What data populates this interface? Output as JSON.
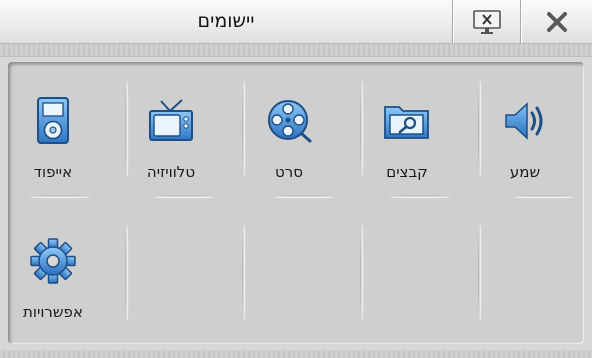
{
  "window": {
    "title": "יישומים",
    "buttons": [
      {
        "name": "display-button",
        "icon": "display-x-icon"
      },
      {
        "name": "close-button",
        "icon": "close-x-icon"
      }
    ]
  },
  "apps": [
    {
      "label": "שמע",
      "icon": "speaker-icon"
    },
    {
      "label": "קבצים",
      "icon": "folder-search-icon"
    },
    {
      "label": "סרט",
      "icon": "film-reel-icon"
    },
    {
      "label": "טלוויזיה",
      "icon": "tv-icon"
    },
    {
      "label": "אייפוד",
      "icon": "ipod-icon"
    },
    {
      "label": "אפשרויות",
      "icon": "gear-icon"
    }
  ],
  "colors": {
    "icon_blue": "#3c86cf",
    "icon_dark": "#1e4f86",
    "background": "#d7d7d7"
  }
}
